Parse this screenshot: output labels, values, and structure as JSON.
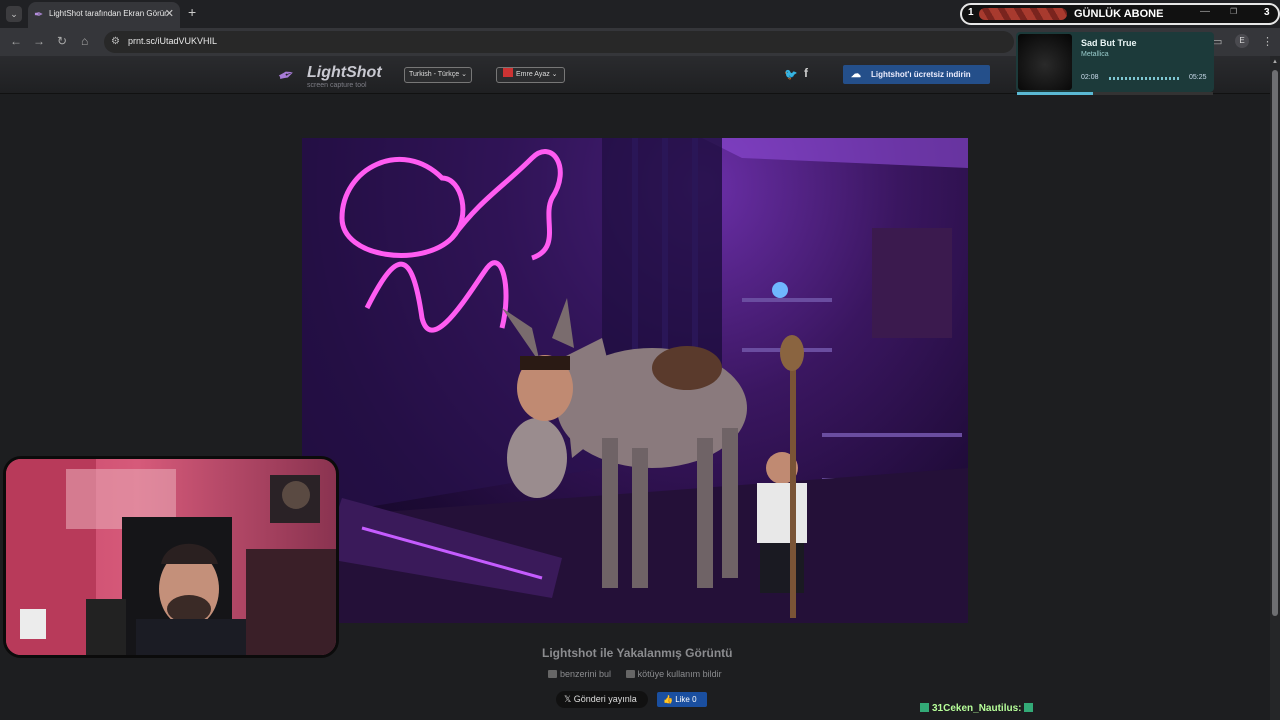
{
  "browser": {
    "tab_title": "LightShot tarafından Ekran Görüntüsü",
    "url": "prnt.sc/iUtadVUKVHIL",
    "profile_initial": "E"
  },
  "lightshot": {
    "logo": "LightShot",
    "logo_sub": "screen capture tool",
    "language": "Turkish - Türkçe",
    "user_name": "Emre Ayaz",
    "download_label": "Lightshot'ı ücretsiz indirin",
    "caption": "Lightshot ile Yakalanmış Görüntü",
    "find_similar": "benzerini bul",
    "report_abuse": "kötüye kullanım bildir",
    "tweet_label": "Gönderi yayınla",
    "like_label": "Like 0"
  },
  "overlay": {
    "sub_goal": {
      "label": "GÜNLÜK ABONE",
      "current": "1",
      "target": "3",
      "progress": 0.33
    },
    "music": {
      "title": "Sad But True",
      "artist": "Metallica",
      "elapsed": "02:08",
      "duration": "05:25",
      "progress": 0.39
    },
    "chat": {
      "message": "31Ceken_Nautilus:"
    }
  },
  "colors": {
    "accent_purple": "#a77bd6",
    "download_blue": "#244f8a",
    "music_bg": "#1c3a3a",
    "chat_green": "#b7ff9a"
  }
}
